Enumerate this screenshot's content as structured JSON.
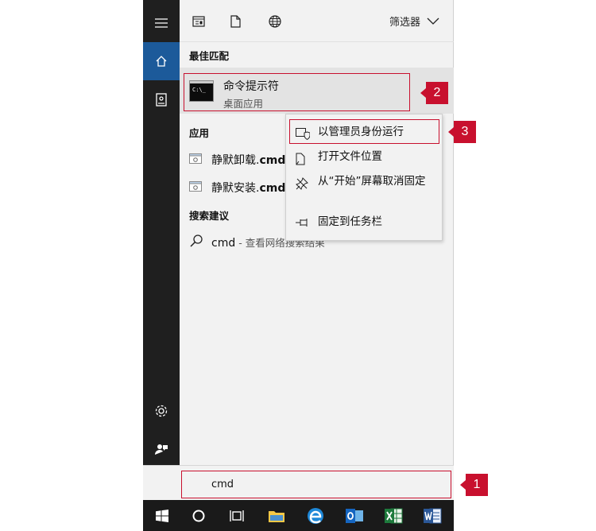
{
  "header": {
    "filter_label": "筛选器"
  },
  "sections": {
    "best_match": "最佳匹配",
    "apps": "应用",
    "suggestions": "搜索建议"
  },
  "best_match": {
    "title": "命令提示符",
    "subtitle": "桌面应用",
    "icon_prompt": "C:\\_"
  },
  "apps": [
    {
      "prefix": "静默卸载.",
      "bold": "cmd"
    },
    {
      "prefix": "静默安装.",
      "bold": "cmd"
    }
  ],
  "suggestion": {
    "query": "cmd",
    "hint": " - 查看网络搜索结果"
  },
  "search": {
    "value": "cmd"
  },
  "context_menu": [
    {
      "label": "以管理员身份运行",
      "icon": "shield-icon"
    },
    {
      "label": "打开文件位置",
      "icon": "file-location-icon"
    },
    {
      "label": "从“开始”屏幕取消固定",
      "icon": "unpin-icon"
    },
    {
      "label": "固定到任务栏",
      "icon": "pin-icon"
    }
  ],
  "callouts": [
    "1",
    "2",
    "3"
  ],
  "colors": {
    "accent": "#1c5a9a",
    "callout": "#c8102e",
    "rail": "#1f1f1f",
    "panel": "#f2f2f2"
  }
}
